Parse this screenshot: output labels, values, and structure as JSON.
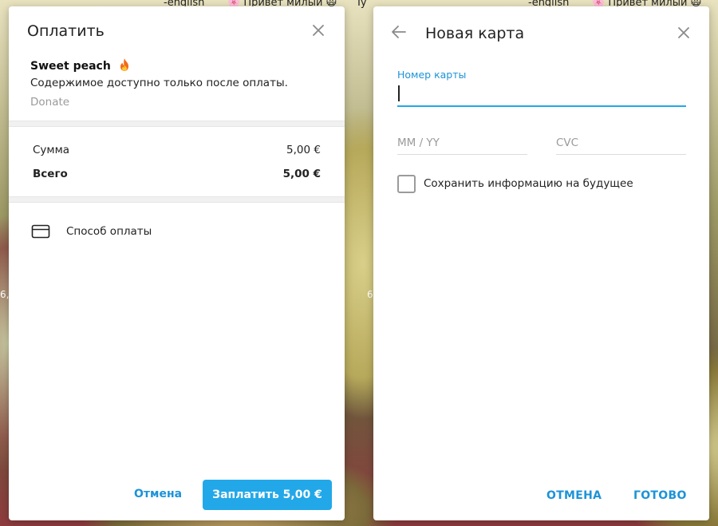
{
  "background": {
    "top_texts": [
      "-english",
      "🌸 Привет милый 🙀",
      "Ty",
      "-english",
      "🌸 Привет милый 🙀"
    ],
    "left_edge_text": "6,",
    "mid_text": "6"
  },
  "payment_dialog": {
    "title": "Оплатить",
    "close_icon": "close-icon",
    "product": {
      "title": "Sweet peach",
      "title_icon": "fire-icon",
      "description": "Содержимое доступно только после оплаты.",
      "provider": "Donate"
    },
    "prices": [
      {
        "label": "Сумма",
        "value": "5,00 €"
      },
      {
        "label": "Всего",
        "value": "5,00 €"
      }
    ],
    "payment_method": {
      "icon": "credit-card-icon",
      "label": "Способ оплаты"
    },
    "cancel_label": "Отмена",
    "pay_label": "Заплатить 5,00 €"
  },
  "card_dialog": {
    "title": "Новая карта",
    "back_icon": "arrow-left-icon",
    "close_icon": "close-icon",
    "card_number_label": "Номер карты",
    "card_number_value": "",
    "expiry_placeholder": "MM / YY",
    "cvc_placeholder": "CVC",
    "save_info_label": "Сохранить информацию на будущее",
    "save_info_checked": false,
    "cancel_label": "ОТМЕНА",
    "done_label": "ГОТОВО"
  },
  "colors": {
    "accent": "#22a8e8",
    "link": "#1c93d8"
  }
}
